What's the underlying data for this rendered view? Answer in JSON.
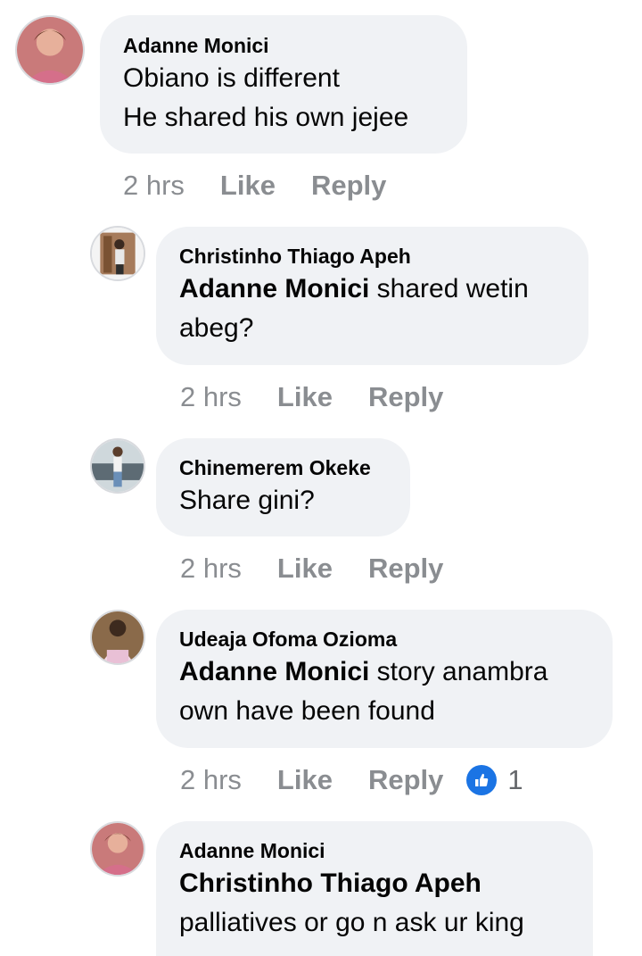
{
  "comments": [
    {
      "author": "Adanne Monici",
      "lines": [
        "Obiano is different",
        "He shared his own jejee"
      ],
      "time": "2 hrs",
      "like": "Like",
      "reply": "Reply"
    },
    {
      "author": "Christinho Thiago Apeh",
      "mention": "Adanne Monici",
      "text_after_mention": " shared wetin",
      "line2": "abeg?",
      "time": "2 hrs",
      "like": "Like",
      "reply": "Reply"
    },
    {
      "author": "Chinemerem Okeke",
      "text": "Share gini?",
      "time": "2 hrs",
      "like": "Like",
      "reply": "Reply"
    },
    {
      "author": "Udeaja Ofoma Ozioma",
      "mention": "Adanne Monici",
      "text_after_mention": " story anambra",
      "line2": "own have been found",
      "time": "2 hrs",
      "like": "Like",
      "reply": "Reply",
      "reaction_count": "1"
    },
    {
      "author": "Adanne Monici",
      "mention": "Christinho Thiago Apeh",
      "line2": "palliatives or go n ask ur king"
    }
  ],
  "icons": {
    "reaction": "like-thumb-icon"
  },
  "colors": {
    "bubble": "#f0f2f5",
    "meta_text": "#8a8d91",
    "like_blue": "#1b74e4"
  }
}
